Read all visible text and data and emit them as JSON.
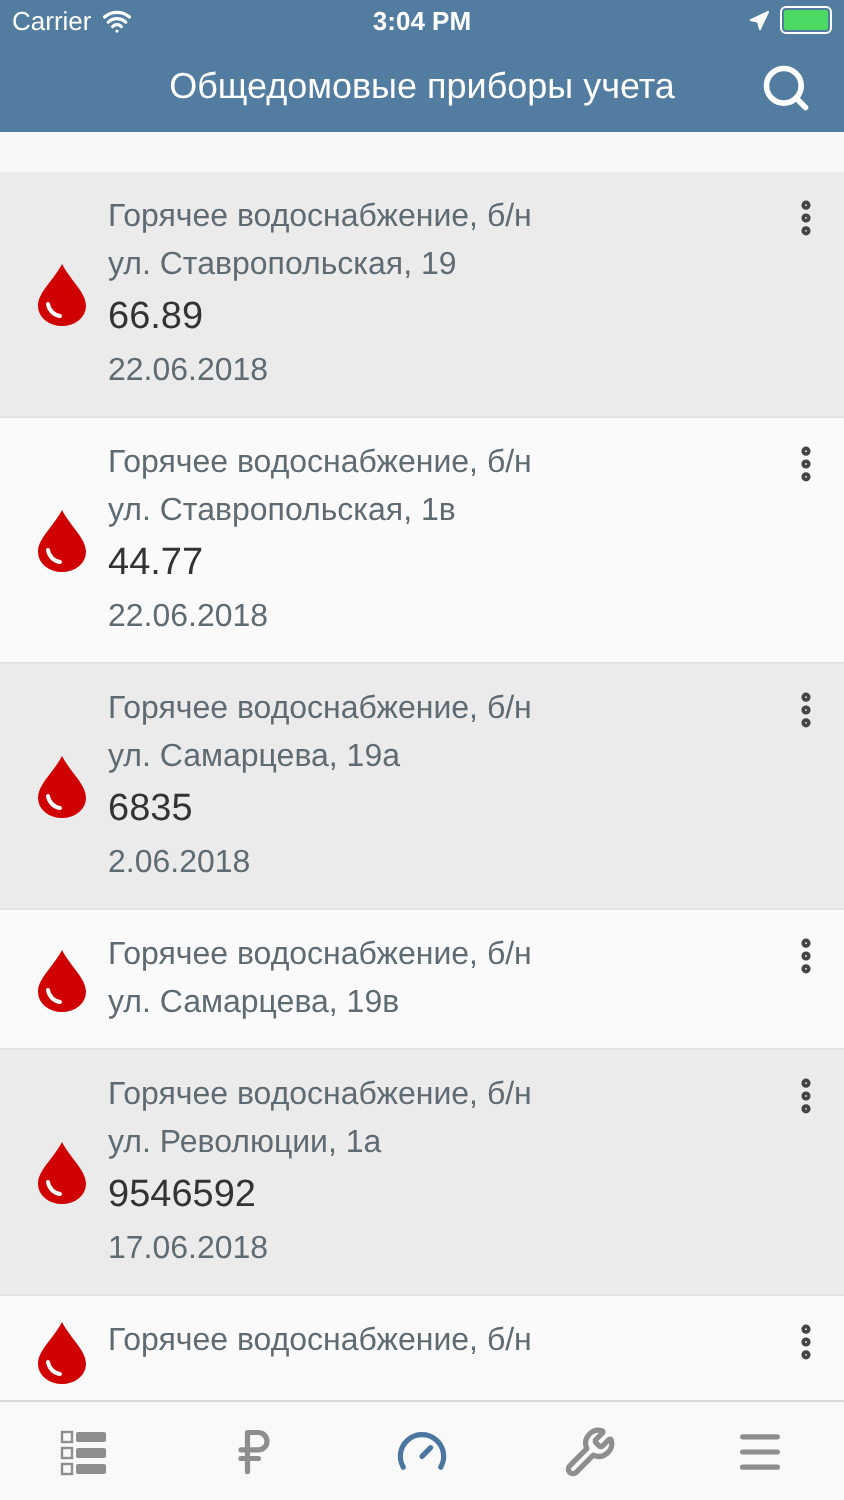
{
  "status_bar": {
    "carrier": "Carrier",
    "time": "3:04 PM"
  },
  "header": {
    "title": "Общедомовые приборы учета"
  },
  "meters": [
    {
      "title": "Горячее водоснабжение, б/н",
      "address": "ул. Ставропольская, 19",
      "reading": "66.89",
      "date": "22.06.2018"
    },
    {
      "title": "Горячее водоснабжение, б/н",
      "address": "ул. Ставропольская, 1в",
      "reading": "44.77",
      "date": "22.06.2018"
    },
    {
      "title": "Горячее водоснабжение, б/н",
      "address": "ул. Самарцева, 19а",
      "reading": "6835",
      "date": "2.06.2018"
    },
    {
      "title": "Горячее водоснабжение, б/н",
      "address": "ул. Самарцева, 19в"
    },
    {
      "title": "Горячее водоснабжение, б/н",
      "address": "ул. Революции, 1а",
      "reading": "9546592",
      "date": "17.06.2018"
    },
    {
      "title": "Горячее водоснабжение, б/н"
    }
  ],
  "tab_bar": [
    {
      "kind": "list",
      "selected": false
    },
    {
      "kind": "ruble",
      "selected": false
    },
    {
      "kind": "gauge",
      "selected": true
    },
    {
      "kind": "wrench",
      "selected": false
    },
    {
      "kind": "menu",
      "selected": false
    }
  ]
}
